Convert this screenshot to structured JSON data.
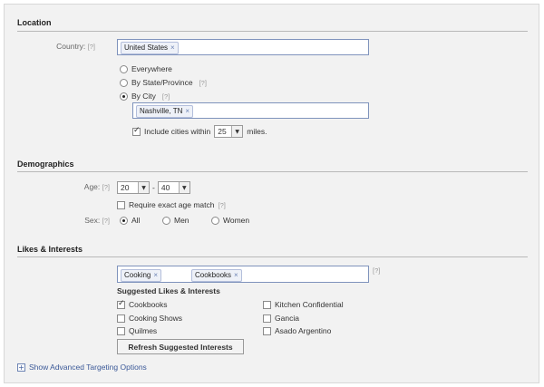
{
  "location": {
    "title": "Location",
    "country_label": "Country:",
    "help": "[?]",
    "country_token": "United States",
    "token_remove": "×",
    "options": {
      "everywhere": "Everywhere",
      "by_state": "By State/Province",
      "by_city": "By City"
    },
    "selected": "by_city",
    "city_token": "Nashville, TN",
    "include_label": "Include cities within",
    "include_checked": true,
    "miles_value": "25",
    "miles_label": "miles."
  },
  "demographics": {
    "title": "Demographics",
    "age_label": "Age:",
    "age_min": "20",
    "age_sep": "-",
    "age_max": "40",
    "exact_label": "Require exact age match",
    "exact_checked": false,
    "sex_label": "Sex:",
    "sex_options": {
      "all": "All",
      "men": "Men",
      "women": "Women"
    },
    "sex_selected": "all"
  },
  "interests": {
    "title": "Likes & Interests",
    "tokens": [
      "Cooking",
      "Cookbooks"
    ],
    "suggested_title": "Suggested Likes & Interests",
    "suggested_left": [
      {
        "label": "Cookbooks",
        "checked": true
      },
      {
        "label": "Cooking Shows",
        "checked": false
      },
      {
        "label": "Quilmes",
        "checked": false
      }
    ],
    "suggested_right": [
      {
        "label": "Kitchen Confidential",
        "checked": false
      },
      {
        "label": "Gancia",
        "checked": false
      },
      {
        "label": "Asado Argentino",
        "checked": false
      }
    ],
    "refresh_label": "Refresh Suggested Interests"
  },
  "advanced_link": "Show Advanced Targeting Options",
  "advanced_icon": "plus-icon",
  "colors": {
    "link": "#3b5998",
    "border": "#7f93bc",
    "background": "#f2f2f2"
  }
}
